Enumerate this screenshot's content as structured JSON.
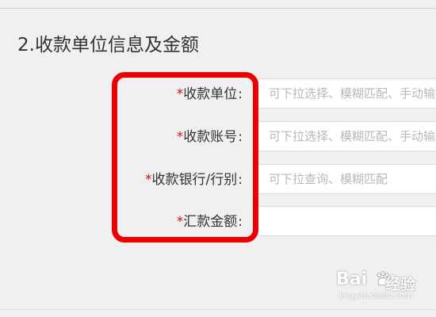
{
  "section": {
    "title": "2.收款单位信息及金额"
  },
  "form": {
    "required_mark": "*",
    "fields": [
      {
        "label": "收款单位",
        "colon": ":",
        "placeholder": "可下拉选择、模糊匹配、手动输入",
        "value": ""
      },
      {
        "label": "收款账号",
        "colon": ":",
        "placeholder": "可下拉选择、模糊匹配、手动输入",
        "value": ""
      },
      {
        "label": "收款银行/行别",
        "colon": ":",
        "placeholder": "可下拉查询、模糊匹配",
        "value": ""
      },
      {
        "label": "汇款金额",
        "colon": ":",
        "placeholder": "",
        "value": ""
      }
    ]
  },
  "watermark": {
    "logo": "Bai",
    "logo_tail": "u",
    "text": "经验",
    "url": "jingyan.baidu.com"
  },
  "colors": {
    "background": "#f0f0f0",
    "required": "#cc1111",
    "highlight": "#ee0000",
    "placeholder": "#b8b8b8"
  }
}
